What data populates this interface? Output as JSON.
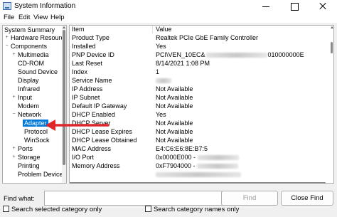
{
  "window": {
    "title": "System Information"
  },
  "menu": [
    "File",
    "Edit",
    "View",
    "Help"
  ],
  "tree": [
    {
      "label": "System Summary",
      "expander": "",
      "level": 0
    },
    {
      "label": "Hardware Resource",
      "expander": "+",
      "level": 1
    },
    {
      "label": "Components",
      "expander": "−",
      "level": 1
    },
    {
      "label": "Multimedia",
      "expander": "+",
      "level": 2
    },
    {
      "label": "CD-ROM",
      "expander": "",
      "level": 2
    },
    {
      "label": "Sound Device",
      "expander": "",
      "level": 2
    },
    {
      "label": "Display",
      "expander": "",
      "level": 2
    },
    {
      "label": "Infrared",
      "expander": "",
      "level": 2
    },
    {
      "label": "Input",
      "expander": "+",
      "level": 2
    },
    {
      "label": "Modem",
      "expander": "",
      "level": 2
    },
    {
      "label": "Network",
      "expander": "−",
      "level": 2
    },
    {
      "label": "Adapter",
      "expander": "",
      "level": 3,
      "selected": true
    },
    {
      "label": "Protocol",
      "expander": "",
      "level": 3
    },
    {
      "label": "WinSock",
      "expander": "",
      "level": 3
    },
    {
      "label": "Ports",
      "expander": "+",
      "level": 2
    },
    {
      "label": "Storage",
      "expander": "+",
      "level": 2
    },
    {
      "label": "Printing",
      "expander": "",
      "level": 2
    },
    {
      "label": "Problem Devices",
      "expander": "",
      "level": 2
    }
  ],
  "list": {
    "headers": {
      "item": "Item",
      "value": "Value"
    },
    "rows": [
      {
        "item": "Product Type",
        "value": "Realtek PCIe GbE Family Controller"
      },
      {
        "item": "Installed",
        "value": "Yes"
      },
      {
        "item": "PNP Device ID",
        "value": "PCI\\VEN_10EC&",
        "value_tail": "010000000E"
      },
      {
        "item": "Last Reset",
        "value": "8/14/2021 1:08 PM"
      },
      {
        "item": "Index",
        "value": "1"
      },
      {
        "item": "Service Name",
        "value": ""
      },
      {
        "item": "IP Address",
        "value": "Not Available"
      },
      {
        "item": "IP Subnet",
        "value": "Not Available"
      },
      {
        "item": "Default IP Gateway",
        "value": "Not Available"
      },
      {
        "item": "DHCP Enabled",
        "value": "Yes"
      },
      {
        "item": "DHCP Server",
        "value": "Not Available"
      },
      {
        "item": "DHCP Lease Expires",
        "value": "Not Available"
      },
      {
        "item": "DHCP Lease Obtained",
        "value": "Not Available"
      },
      {
        "item": "MAC Address",
        "value": "E4:C6:E6:8E:B7:5"
      },
      {
        "item": "I/O Port",
        "value": "0x0000E000 -"
      },
      {
        "item": "Memory Address",
        "value": "0xF7904000 -"
      }
    ]
  },
  "find": {
    "label": "Find what:",
    "input_value": "",
    "find_button": "Find",
    "close_button": "Close Find",
    "search_selected": "Search selected category only",
    "search_names": "Search category names only"
  },
  "colors": {
    "selection": "#0078d7",
    "annotation_arrow": "#e0262b"
  }
}
